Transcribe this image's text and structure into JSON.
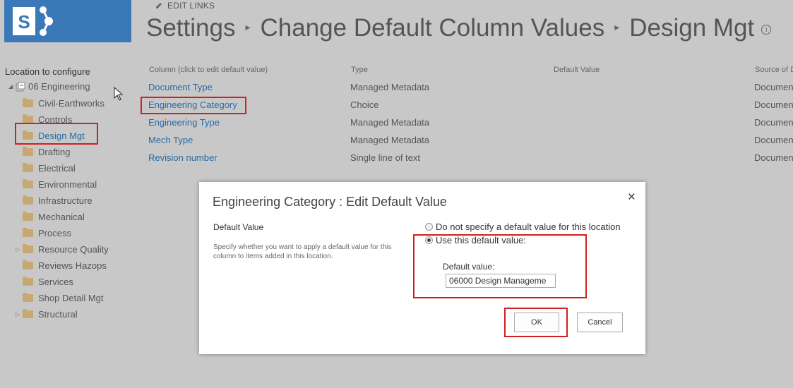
{
  "header": {
    "edit_links": "EDIT LINKS",
    "breadcrumb": [
      "Settings",
      "Change Default Column Values",
      "Design Mgt"
    ],
    "info_glyph": "i"
  },
  "sidebar": {
    "label": "Location to configure",
    "root": "06 Engineering",
    "items": [
      {
        "label": "Civil-Earthworks",
        "expandable": false
      },
      {
        "label": "Controls",
        "expandable": false
      },
      {
        "label": "Design Mgt",
        "expandable": false,
        "selected": true
      },
      {
        "label": "Drafting",
        "expandable": false
      },
      {
        "label": "Electrical",
        "expandable": false
      },
      {
        "label": "Environmental",
        "expandable": false
      },
      {
        "label": "Infrastructure",
        "expandable": false
      },
      {
        "label": "Mechanical",
        "expandable": false
      },
      {
        "label": "Process",
        "expandable": false
      },
      {
        "label": "Resource Quality",
        "expandable": true
      },
      {
        "label": "Reviews Hazops",
        "expandable": false
      },
      {
        "label": "Services",
        "expandable": false
      },
      {
        "label": "Shop Detail Mgt",
        "expandable": false
      },
      {
        "label": "Structural",
        "expandable": true
      }
    ]
  },
  "table": {
    "headers": [
      "Column (click to edit default value)",
      "Type",
      "Default Value",
      "Source of D"
    ],
    "rows": [
      {
        "column": "Document Type",
        "type": "Managed Metadata",
        "default": "",
        "source": "Documen"
      },
      {
        "column": "Engineering Category",
        "type": "Choice",
        "default": "",
        "source": "Documen"
      },
      {
        "column": "Engineering Type",
        "type": "Managed Metadata",
        "default": "",
        "source": "Documen"
      },
      {
        "column": "Mech Type",
        "type": "Managed Metadata",
        "default": "",
        "source": "Documen"
      },
      {
        "column": "Revision number",
        "type": "Single line of text",
        "default": "",
        "source": "Documen"
      }
    ]
  },
  "dialog": {
    "title": "Engineering Category : Edit Default Value",
    "close": "×",
    "section_label": "Default Value",
    "description": "Specify whether you want to apply a default value for this column to items added in this location.",
    "option_none": "Do not specify a default value for this location",
    "option_use": "Use this default value:",
    "default_value_label": "Default value:",
    "default_value": "06000 Design Manageme",
    "ok": "OK",
    "cancel": "Cancel"
  },
  "colors": {
    "brand": "#3b78b8",
    "link": "#2a6aa6",
    "highlight": "#d21f1f"
  }
}
